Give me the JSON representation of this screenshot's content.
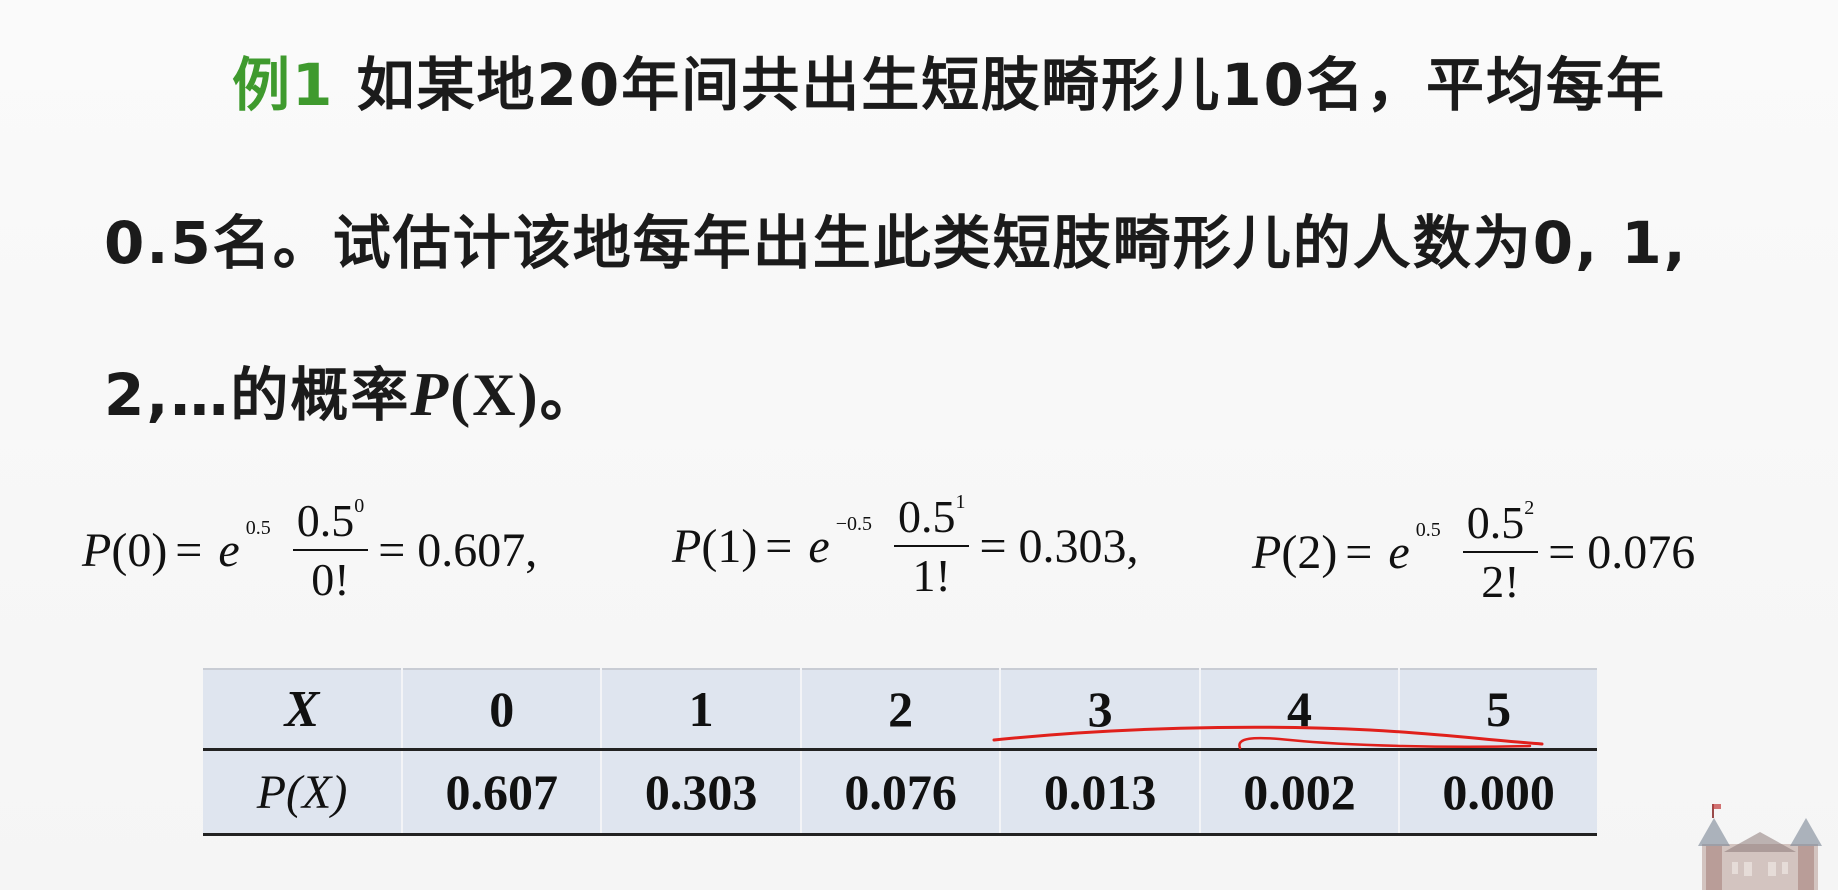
{
  "problem": {
    "example_label": "例1",
    "line1_text": " 如某地20年间共出生短肢畸形儿10名，平均每年",
    "line2_text": "0.5名。试估计该地每年出生此类短肢畸形儿的人数为0, 1,",
    "line3_prefix": "2,…的概率",
    "line3_p": "P",
    "line3_x": "(X)",
    "line3_suffix": "。"
  },
  "formulas": [
    {
      "lhs_p": "P",
      "lhs_arg": "(0)",
      "eq": "=",
      "base": "e",
      "exponent": " 0.5",
      "num": "0.5",
      "num_sup": "0",
      "den": "0!",
      "result": "= 0.607,"
    },
    {
      "lhs_p": "P",
      "lhs_arg": "(1)",
      "eq": "=",
      "base": "e",
      "exponent": "−0.5",
      "num": "0.5",
      "num_sup": "1",
      "den": "1!",
      "result": "= 0.303,"
    },
    {
      "lhs_p": "P",
      "lhs_arg": "(2)",
      "eq": "=",
      "base": "e",
      "exponent": " 0.5",
      "num": "0.5",
      "num_sup": "2",
      "den": "2!",
      "result": "= 0.076"
    }
  ],
  "table": {
    "x_header": "X",
    "p_header": "P(X)",
    "x_values": [
      "0",
      "1",
      "2",
      "3",
      "4",
      "5"
    ],
    "p_values": [
      "0.607",
      "0.303",
      "0.076",
      "0.013",
      "0.002",
      "0.000"
    ]
  },
  "colors": {
    "example_label": "#3f9a2e",
    "table_bg": "#dfe5ef",
    "pen": "#e0201c"
  }
}
